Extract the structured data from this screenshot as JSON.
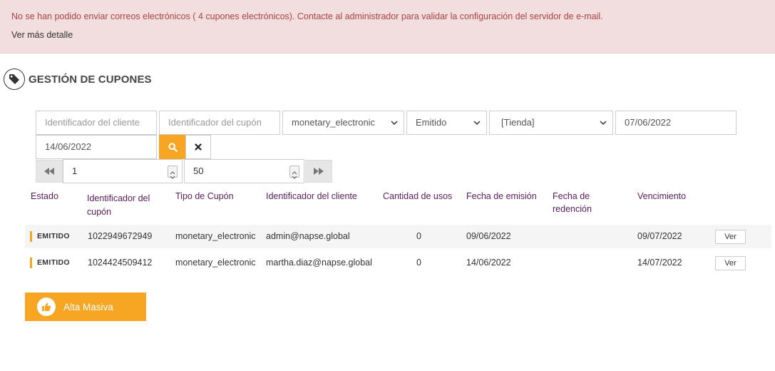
{
  "alert": {
    "message": "No se han podido enviar correos electrónicos ( 4 cupones electrónicos). Contacte al administrador para validar la configuración del servidor de e-mail.",
    "details_link": "Ver más detalle"
  },
  "page": {
    "title": "GESTIÓN DE CUPONES",
    "title_icon": "tag-icon"
  },
  "filters": {
    "client_id_placeholder": "Identificador del cliente",
    "coupon_id_placeholder": "Identificador del cupón",
    "coupon_type_selected": "monetary_electronic",
    "status_selected": "Emitido",
    "store_selected": "[Tienda]",
    "date_from": "07/06/2022",
    "date_to": "14/06/2022"
  },
  "pagination": {
    "page": "1",
    "page_size": "50"
  },
  "table": {
    "headers": {
      "estado": "Estado",
      "id_line1": "Identificador del",
      "id_line2": "cupón",
      "tipo": "Tipo de Cupón",
      "cliente": "Identificador del cliente",
      "cantidad": "Cantidad de usos",
      "emision": "Fecha de emisión",
      "redencion_line1": "Fecha de",
      "redencion_line2": "redención",
      "vencimiento": "Vencimiento"
    },
    "rows": [
      {
        "estado": "EMITIDO",
        "id": "1022949672949",
        "tipo": "monetary_electronic",
        "cliente": "admin@napse.global",
        "cantidad": "0",
        "emision": "09/06/2022",
        "redencion": "",
        "vencimiento": "09/07/2022",
        "action": "Ver"
      },
      {
        "estado": "EMITIDO",
        "id": "1024424509412",
        "tipo": "monetary_electronic",
        "cliente": "martha.diaz@napse.global",
        "cantidad": "0",
        "emision": "14/06/2022",
        "redencion": "",
        "vencimiento": "14/07/2022",
        "action": "Ver"
      }
    ]
  },
  "actions": {
    "bulk_upload_label": "Alta Masiva",
    "bulk_upload_icon": "thumbs-up-icon"
  },
  "colors": {
    "accent": "#f6a623",
    "alert_bg": "#f2dede",
    "alert_text": "#a94442",
    "header_text": "#5a1a5a"
  }
}
